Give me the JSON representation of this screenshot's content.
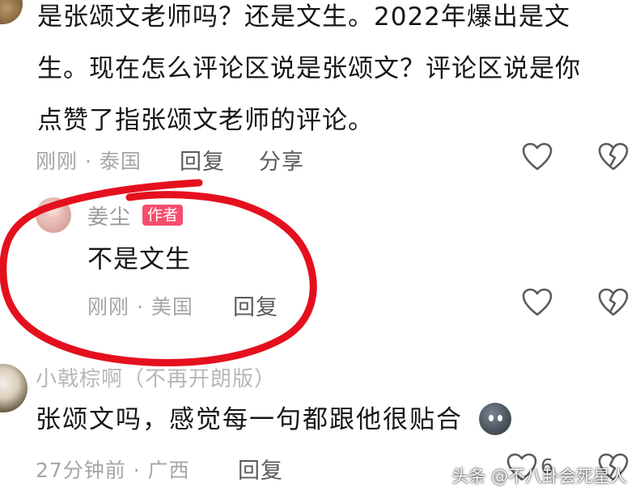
{
  "comments": [
    {
      "text_lines": [
        "是张颂文老师吗？还是文生。2022年爆出是文",
        "生。现在怎么评论区说是张颂文？评论区说是你",
        "点赞了指张颂文老师的评论。"
      ],
      "meta": "刚刚 · 泰国",
      "reply_label": "回复",
      "share_label": "分享"
    },
    {
      "username": "姜尘",
      "badge": "作者",
      "text": "不是文生",
      "meta": "刚刚 · 美国",
      "reply_label": "回复"
    },
    {
      "username": "小戟棕啊（不再开朗版）",
      "text": "张颂文吗，感觉每一句都跟他很贴合",
      "meta": "27分钟前 · 广西",
      "reply_label": "回复",
      "like_count": "6"
    }
  ],
  "icons": {
    "like": "heart-outline-icon",
    "dislike": "broken-heart-icon",
    "emoji": "emoji-face-icon"
  },
  "watermark": "头条 @不八卦会死星人",
  "colors": {
    "text": "#161616",
    "meta": "#a6a6a6",
    "action": "#5b5b5b",
    "badge": "#f54e6d",
    "annotation": "#e5101e"
  }
}
